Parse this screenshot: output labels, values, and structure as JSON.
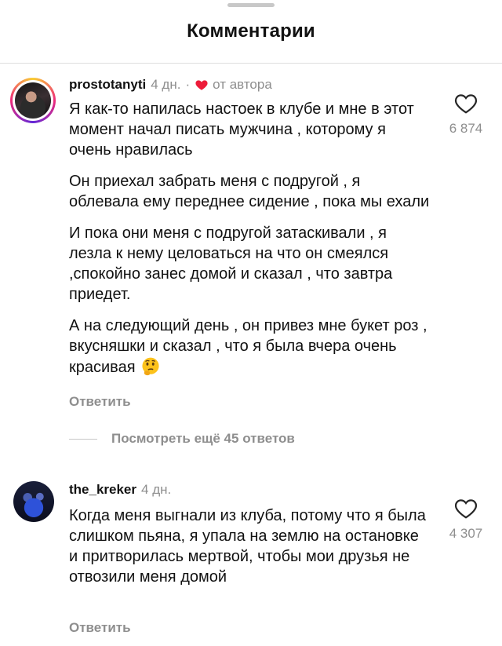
{
  "header": {
    "title": "Комментарии"
  },
  "comments": [
    {
      "username": "prostotanyti",
      "time": "4 дн.",
      "separator": "·",
      "author_like_label": "от автора",
      "paragraphs": [
        "Я как-то напилась настоек в клубе и мне в этот момент начал писать мужчина , которому я очень нравилась",
        "Он приехал забрать меня с подругой , я облевала ему переднее сидение , пока мы ехали",
        "И пока они меня с подругой затаскивали , я лезла к нему целоваться на что он смеялся ,спокойно занес домой и сказал , что завтра приедет.",
        "А на следующий день , он привез мне букет роз , вкусняшки и сказал , что я была вчера очень красивая"
      ],
      "emoji": "thinking-face",
      "likes": "6 874",
      "reply_label": "Ответить",
      "more_replies_label": "Посмотреть ещё 45 ответов"
    },
    {
      "username": "the_kreker",
      "time": "4 дн.",
      "paragraphs": [
        "Когда меня выгнали из клуба, потому что я была слишком пьяна, я упала на землю на остановке и притворилась мертвой, чтобы мои друзья не отвозили меня домой"
      ],
      "likes": "4 307",
      "reply_label": "Ответить"
    }
  ],
  "colors": {
    "text": "#111111",
    "secondary": "#8e8e8e",
    "heart_red": "#ed1c3a",
    "divider": "#dedede"
  }
}
